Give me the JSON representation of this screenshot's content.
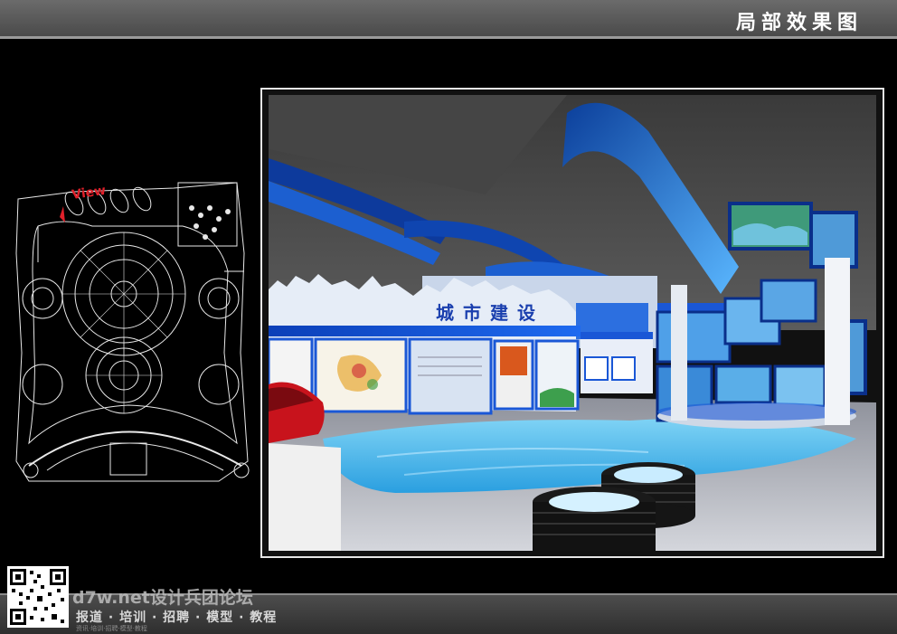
{
  "header": {
    "title": "局部效果图"
  },
  "plan": {
    "view_label": "View"
  },
  "render": {
    "sign_text": "城市建设"
  },
  "watermark": {
    "line1": "d7w.net设计兵团论坛",
    "line2": "报道 · 培训 · 招聘 · 模型 · 教程",
    "line3": "资讯·培训·招聘·模型·教程"
  },
  "colors": {
    "accent": "#1a57d6",
    "water": "#3fb4ea",
    "background": "#000000"
  }
}
